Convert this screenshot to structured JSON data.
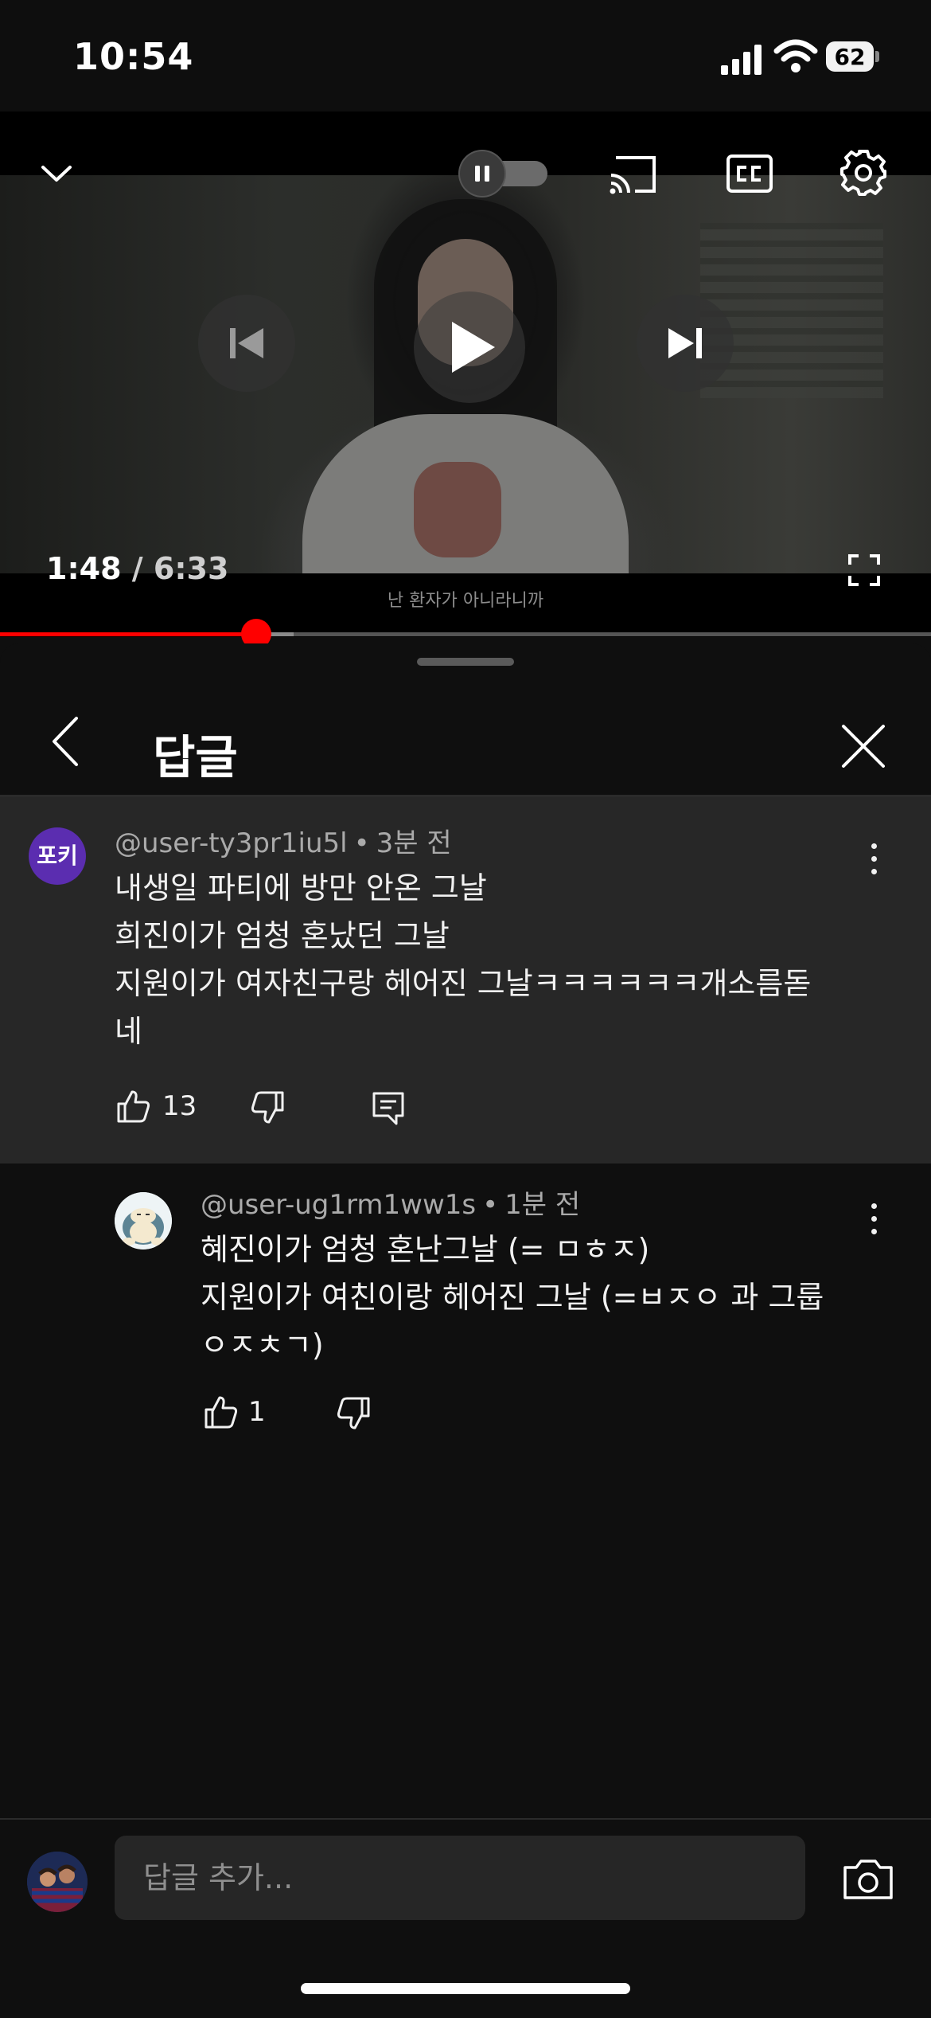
{
  "status_bar": {
    "time": "10:54",
    "battery": "62"
  },
  "player": {
    "current_time": "1:48",
    "separator": "/",
    "duration": "6:33",
    "caption": "난 환자가 아니라니까",
    "progress_fraction": 0.275,
    "buffered_fraction": 0.315
  },
  "panel": {
    "title": "답글"
  },
  "parent_comment": {
    "avatar_text": "포키",
    "author": "@user-ty3pr1iu5l",
    "time": "3분 전",
    "lines": [
      "내생일 파티에 방만 안온 그날",
      "희진이가 엄청 혼났던 그날",
      "지원이가 여자친구랑 헤어진 그날ㅋㅋㅋㅋㅋㅋ개소름돋",
      "네"
    ],
    "likes": "13"
  },
  "reply_comment": {
    "author": "@user-ug1rm1ww1s",
    "time": "1분 전",
    "lines": [
      "혜진이가 엄청 혼난그날 (= ㅁㅎㅈ)",
      "지원이가 여친이랑 헤어진 그날 (=ㅂㅈㅇ 과 그룹",
      "ㅇㅈㅊㄱ)"
    ],
    "likes": "1"
  },
  "input": {
    "placeholder": "답글 추가..."
  },
  "colors": {
    "accent": "#ff0000",
    "panel_bg": "#0f0f0f",
    "highlight_bg": "#272727",
    "avatar_purple": "#5b2db0"
  }
}
